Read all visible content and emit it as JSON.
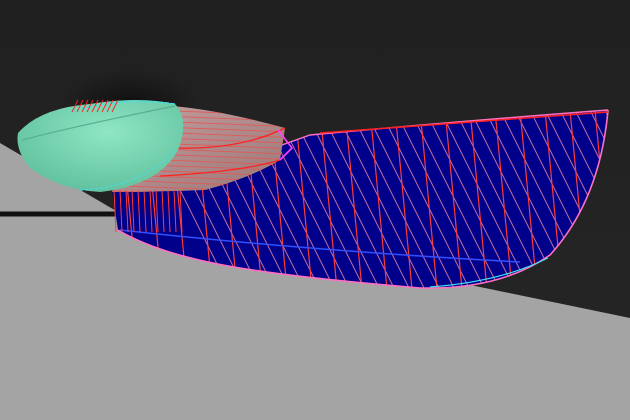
{
  "viewport": {
    "background_top": "#202020",
    "background_bottom": "#242424",
    "ground_color": "#a4a4a4",
    "ground_edge_color": "#111111"
  },
  "model": {
    "hull_fill": "#00008a",
    "hull_hatch": "#ff3a3a",
    "hull_diag_hatch": "#c070a0",
    "hull_outline": "#ff70c0",
    "edge_highlight": "#40e0f0",
    "inner_surface": "#b08a8a",
    "inner_hatch": "#e05a5a",
    "canopy_fill": "#78d8b4",
    "canopy_shade": "#5cb898",
    "waterline": "#3050ff",
    "feature_line": "#ff2020"
  }
}
